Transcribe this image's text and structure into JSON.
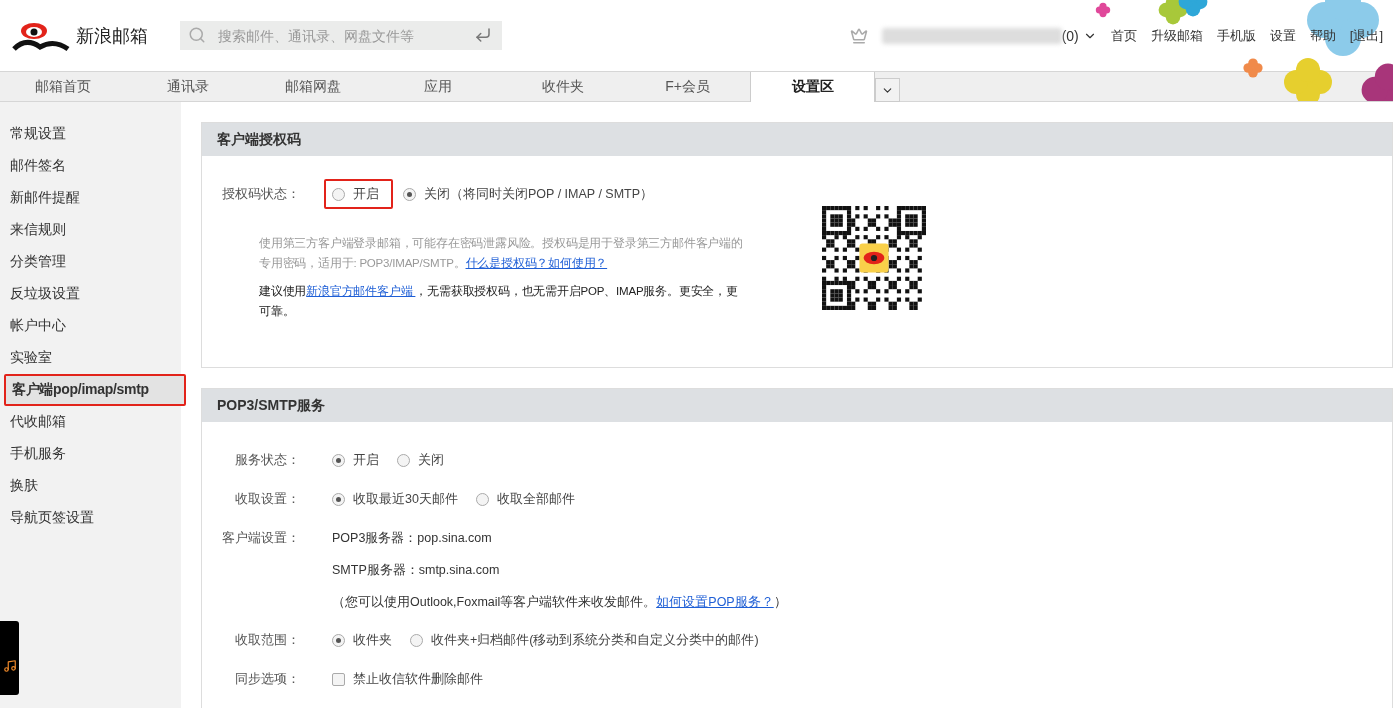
{
  "header": {
    "logo_text": "新浪邮箱",
    "search": {
      "placeholder": "搜索邮件、通讯录、网盘文件等"
    },
    "account_count": "(0)",
    "links": [
      "首页",
      "升级邮箱",
      "手机版",
      "设置",
      "帮助",
      "[退出]"
    ]
  },
  "tabs": [
    {
      "label": "邮箱首页",
      "selected": false
    },
    {
      "label": "通讯录",
      "selected": false
    },
    {
      "label": "邮箱网盘",
      "selected": false
    },
    {
      "label": "应用",
      "selected": false
    },
    {
      "label": "收件夹",
      "selected": false
    },
    {
      "label": "F+会员",
      "selected": false
    },
    {
      "label": "设置区",
      "selected": true
    }
  ],
  "sidebar": {
    "items": [
      {
        "label": "常规设置",
        "selected": false
      },
      {
        "label": "邮件签名",
        "selected": false
      },
      {
        "label": "新邮件提醒",
        "selected": false
      },
      {
        "label": "来信规则",
        "selected": false
      },
      {
        "label": "分类管理",
        "selected": false
      },
      {
        "label": "反垃圾设置",
        "selected": false
      },
      {
        "label": "帐户中心",
        "selected": false
      },
      {
        "label": "实验室",
        "selected": false
      },
      {
        "label": "客户端pop/imap/smtp",
        "selected": true
      },
      {
        "label": "代收邮箱",
        "selected": false
      },
      {
        "label": "手机服务",
        "selected": false
      },
      {
        "label": "换肤",
        "selected": false
      },
      {
        "label": "导航页签设置",
        "selected": false
      }
    ]
  },
  "auth_section": {
    "title": "客户端授权码",
    "status_label": "授权码状态：",
    "options": [
      {
        "label": "开启",
        "selected": false,
        "highlighted": true
      },
      {
        "label": "关闭（将同时关闭POP / IMAP / SMTP）",
        "selected": true,
        "highlighted": false
      }
    ],
    "notes": [
      {
        "kind": "muted",
        "parts": [
          {
            "text": "使用第三方客户端登录邮箱，可能存在密码泄露风险。授权码是用于登录第三方邮件客户端的专用密码，适用于: POP3/IMAP/SMTP。",
            "link": false
          },
          {
            "text": "什么是授权码？如何使用？",
            "link": true
          }
        ]
      },
      {
        "kind": "plain",
        "parts": [
          {
            "text": "建议使用",
            "link": false
          },
          {
            "text": "新浪官方邮件客户端 ",
            "link": true
          },
          {
            "text": "，无需获取授权码，也无需开启POP、IMAP服务。更安全，更可靠。",
            "link": false
          }
        ]
      }
    ]
  },
  "pop_section": {
    "title": "POP3/SMTP服务",
    "rows": [
      {
        "kind": "radio",
        "label": "服务状态：",
        "options": [
          {
            "label": "开启",
            "selected": true
          },
          {
            "label": "关闭",
            "selected": false
          }
        ]
      },
      {
        "kind": "radio",
        "label": "收取设置：",
        "options": [
          {
            "label": "收取最近30天邮件",
            "selected": true
          },
          {
            "label": "收取全部邮件",
            "selected": false
          }
        ]
      },
      {
        "kind": "info",
        "label": "客户端设置：",
        "lines": [
          {
            "parts": [
              {
                "text": "POP3服务器：pop.sina.com",
                "link": false
              }
            ]
          },
          {
            "parts": [
              {
                "text": "SMTP服务器：smtp.sina.com",
                "link": false
              }
            ]
          },
          {
            "parts": [
              {
                "text": "（您可以使用Outlook,Foxmail等客户端软件来收发邮件。",
                "link": false
              },
              {
                "text": "如何设置POP服务？",
                "link": true
              },
              {
                "text": "）",
                "link": false
              }
            ]
          }
        ]
      },
      {
        "kind": "radio",
        "label": "收取范围：",
        "options": [
          {
            "label": "收件夹",
            "selected": true
          },
          {
            "label": "收件夹+归档邮件(移动到系统分类和自定义分类中的邮件)",
            "selected": false
          }
        ]
      },
      {
        "kind": "checkbox",
        "label": "同步选项：",
        "options": [
          {
            "label": "禁止收信软件删除邮件",
            "selected": false
          }
        ]
      }
    ]
  }
}
